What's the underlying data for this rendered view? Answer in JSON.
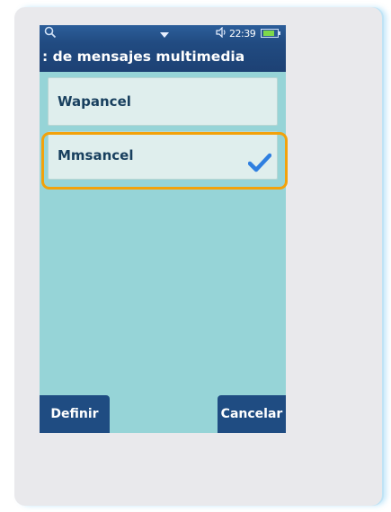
{
  "status_bar": {
    "time": "22:39",
    "icons": [
      "search-icon",
      "arrow-down-icon",
      "sound-icon",
      "battery-icon"
    ]
  },
  "title": ": de mensajes multimedia",
  "list": {
    "items": [
      {
        "label": "Wapancel",
        "selected": false
      },
      {
        "label": "Mmsancel",
        "selected": true
      }
    ]
  },
  "softkeys": {
    "left_label": "Definir",
    "right_label": "Cancelar"
  },
  "colors": {
    "accent": "#f2a20b",
    "header": "#214b81",
    "screen_bg": "#96d4d7",
    "check": "#2f7fe0"
  }
}
